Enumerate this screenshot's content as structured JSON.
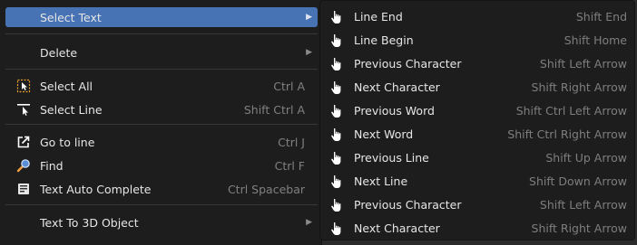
{
  "menu": {
    "items": [
      {
        "label": "Select Text",
        "shortcut": "",
        "submenu": true,
        "icon": "none"
      },
      {
        "label": "Delete",
        "shortcut": "",
        "submenu": true,
        "icon": "none"
      },
      {
        "label": "Select All",
        "shortcut": "Ctrl A",
        "submenu": false,
        "icon": "select-all-icon"
      },
      {
        "label": "Select Line",
        "shortcut": "Shift Ctrl A",
        "submenu": false,
        "icon": "select-line-icon"
      },
      {
        "label": "Go to line",
        "shortcut": "Ctrl J",
        "submenu": false,
        "icon": "go-to-line-icon"
      },
      {
        "label": "Find",
        "shortcut": "Ctrl F",
        "submenu": false,
        "icon": "find-icon"
      },
      {
        "label": "Text Auto Complete",
        "shortcut": "Ctrl Spacebar",
        "submenu": false,
        "icon": "auto-complete-icon"
      },
      {
        "label": "Text To 3D Object",
        "shortcut": "",
        "submenu": true,
        "icon": "none"
      }
    ]
  },
  "submenu": {
    "items": [
      {
        "label": "Line End",
        "shortcut": "Shift End"
      },
      {
        "label": "Line Begin",
        "shortcut": "Shift Home"
      },
      {
        "label": "Previous Character",
        "shortcut": "Shift Left Arrow"
      },
      {
        "label": "Next Character",
        "shortcut": "Shift Right Arrow"
      },
      {
        "label": "Previous Word",
        "shortcut": "Shift Ctrl Left Arrow"
      },
      {
        "label": "Next Word",
        "shortcut": "Shift Ctrl Right Arrow"
      },
      {
        "label": "Previous Line",
        "shortcut": "Shift Up Arrow"
      },
      {
        "label": "Next Line",
        "shortcut": "Shift Down Arrow"
      },
      {
        "label": "Previous Character",
        "shortcut": "Shift Left Arrow"
      },
      {
        "label": "Next Character",
        "shortcut": "Shift Right Arrow"
      }
    ]
  },
  "colors": {
    "highlight": "#4772b3",
    "menu_bg": "#1d1d1d",
    "shortcut": "#808080"
  }
}
